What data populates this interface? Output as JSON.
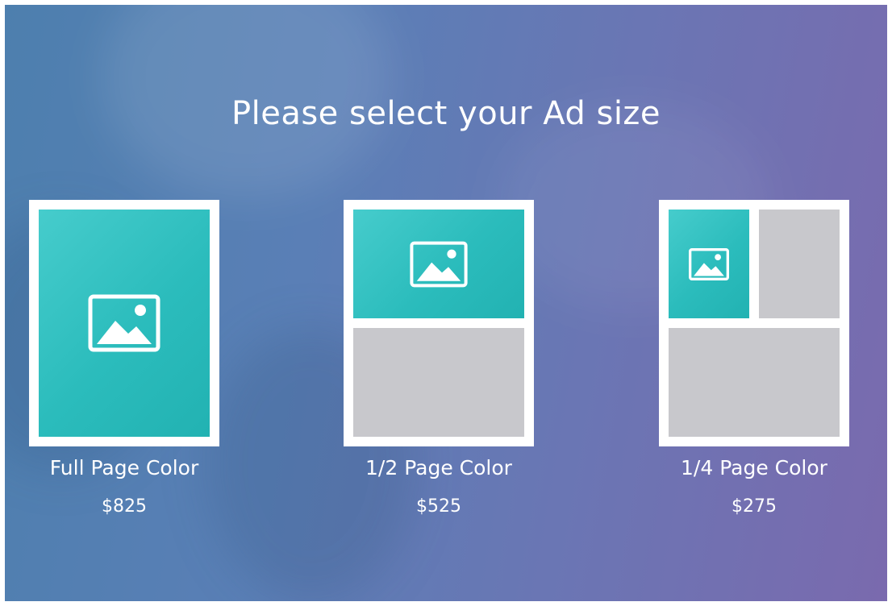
{
  "headline": "Please select your Ad size",
  "colors": {
    "accent_teal": "#2bbcbc",
    "placeholder_gray": "#c8c8cc",
    "background_start": "#4d7fae",
    "background_end": "#7a6aae"
  },
  "options": [
    {
      "label": "Full Page Color",
      "price": "$825",
      "icon": "image-icon"
    },
    {
      "label": "1/2 Page Color",
      "price": "$525",
      "icon": "image-icon"
    },
    {
      "label": "1/4 Page Color",
      "price": "$275",
      "icon": "image-icon"
    }
  ]
}
